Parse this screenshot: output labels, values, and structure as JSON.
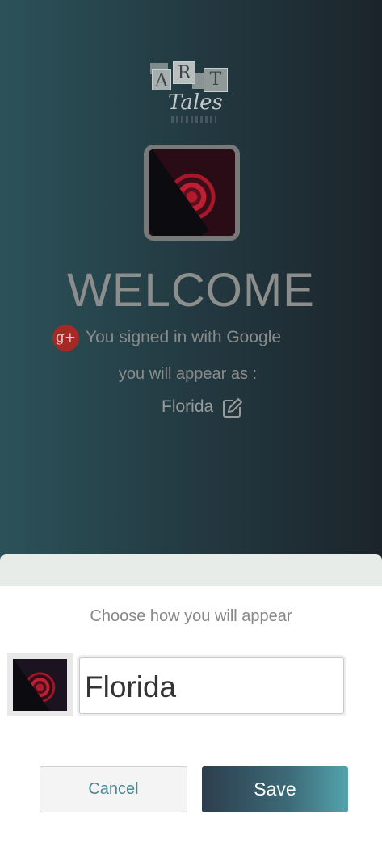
{
  "logo": {
    "letters": [
      "A",
      "R",
      "T"
    ],
    "subtitle": "Tales",
    "icon": "art-tales-logo"
  },
  "profile": {
    "avatar_icon": "avatar-image"
  },
  "welcome": {
    "title": "WELCOME",
    "signed_in_text": "You signed in with Google",
    "google_icon": "google-plus-icon",
    "appear_as_text": "you will appear as :",
    "display_name": "Florida",
    "edit_icon": "edit-icon"
  },
  "sheet": {
    "heading": "Choose how you will appear",
    "name_value": "Florida",
    "cancel_label": "Cancel",
    "save_label": "Save"
  },
  "colors": {
    "background_start": "#2c5259",
    "background_end": "#1c242b",
    "google_red": "#a52a25",
    "save_gradient_start": "#2c3d4d",
    "save_gradient_end": "#52a4ad",
    "cancel_text": "#4f8793"
  }
}
